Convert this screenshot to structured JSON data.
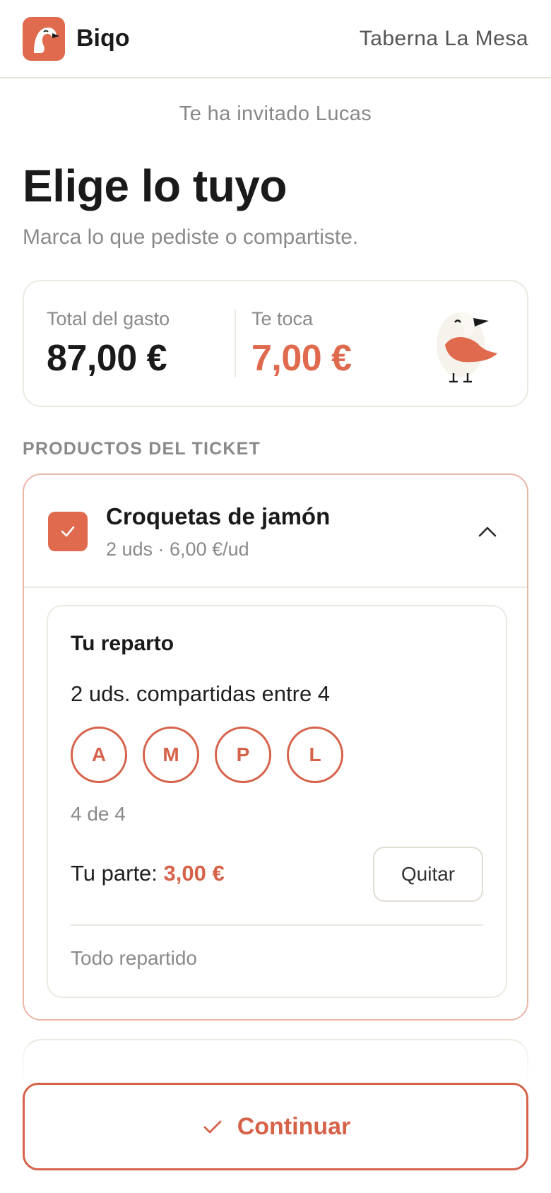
{
  "header": {
    "brand_name": "Biqo",
    "venue_name": "Taberna La Mesa"
  },
  "invite_text": "Te ha invitado Lucas",
  "page_title": "Elige lo tuyo",
  "page_subtitle": "Marca lo que pediste o compartiste.",
  "summary": {
    "total_label": "Total del gasto",
    "total_value": "87,00 €",
    "share_label": "Te toca",
    "share_value": "7,00 €"
  },
  "products_section_label": "PRODUCTOS DEL TICKET",
  "product": {
    "name": "Croquetas de jamón",
    "meta": "2 uds · 6,00 €/ud",
    "checked": true,
    "expanded": true,
    "split": {
      "title": "Tu reparto",
      "description": "2 uds. compartidas entre 4",
      "participants": [
        "A",
        "M",
        "P",
        "L"
      ],
      "count_text": "4 de 4",
      "your_part_label": "Tu parte: ",
      "your_part_value": "3,00 €",
      "remove_label": "Quitar",
      "status_text": "Todo repartido"
    }
  },
  "continue_label": "Continuar",
  "colors": {
    "accent": "#e06a4e",
    "accent_dark": "#d6624a",
    "border": "#ece9e2",
    "muted_text": "#8a8a8a"
  },
  "icons": [
    "bird-logo-icon",
    "bird-mascot-icon",
    "checkmark-icon",
    "chevron-up-icon",
    "check-icon"
  ]
}
